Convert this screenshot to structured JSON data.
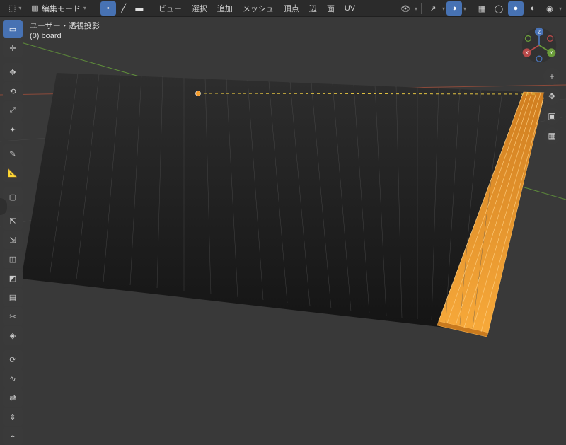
{
  "header": {
    "mode_dropdown": "編集モード",
    "menu": {
      "view": "ビュー",
      "select": "選択",
      "add": "追加",
      "mesh": "メッシュ",
      "vertex": "頂点",
      "edge": "辺",
      "face": "面",
      "uv": "UV"
    },
    "select_mode": {
      "vertex": "頂点",
      "edge": "辺",
      "face": "面"
    }
  },
  "overlay": {
    "projection": "ユーザー・透視投影",
    "object_label": "(0) board"
  },
  "toolbar": {
    "tools": [
      {
        "name": "select-box-tool",
        "active": true
      },
      {
        "name": "cursor-tool",
        "active": false
      },
      {
        "name": "move-tool",
        "active": false
      },
      {
        "name": "rotate-tool",
        "active": false
      },
      {
        "name": "scale-tool",
        "active": false
      },
      {
        "name": "transform-tool",
        "active": false
      },
      {
        "name": "annotate-tool",
        "active": false
      },
      {
        "name": "measure-tool",
        "active": false
      },
      {
        "name": "add-cube-tool",
        "active": false
      },
      {
        "name": "extrude-region-tool",
        "active": false
      },
      {
        "name": "extrude-manifold-tool",
        "active": false
      },
      {
        "name": "inset-faces-tool",
        "active": false
      },
      {
        "name": "bevel-tool",
        "active": false
      },
      {
        "name": "loop-cut-tool",
        "active": false
      },
      {
        "name": "knife-tool",
        "active": false
      },
      {
        "name": "poly-build-tool",
        "active": false
      },
      {
        "name": "spin-tool",
        "active": false
      },
      {
        "name": "smooth-tool",
        "active": false
      },
      {
        "name": "edge-slide-tool",
        "active": false
      },
      {
        "name": "shrink-fatten-tool",
        "active": false
      },
      {
        "name": "rip-region-tool",
        "active": false
      }
    ]
  },
  "nav": {
    "zoom": "+",
    "pan": "✥",
    "camera": "▣",
    "perspective": "▦"
  },
  "gizmo_axes": {
    "x": "X",
    "y": "Y",
    "z": "Z"
  },
  "colors": {
    "bg": "#393939",
    "mesh_dark": "#1f1f1f",
    "select_orange": "#f79b2c",
    "axis_x": "#b84a4a",
    "axis_y": "#6a9c3a",
    "axis_z": "#4a74b8",
    "grid": "#4a4a4a"
  }
}
